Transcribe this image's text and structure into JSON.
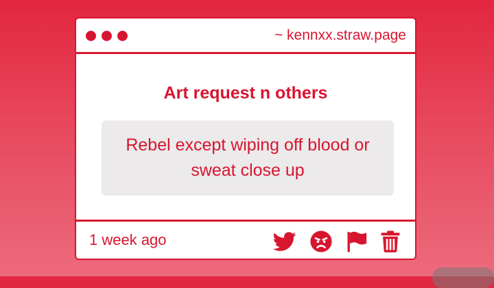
{
  "window": {
    "site_label": "~ kennxx.straw.page"
  },
  "post": {
    "heading": "Art request n others",
    "message": "Rebel except wiping off blood or sweat close up",
    "timestamp": "1 week ago"
  },
  "actions": [
    {
      "icon": "twitter-icon",
      "label": "Share on Twitter"
    },
    {
      "icon": "angry-face-icon",
      "label": "React"
    },
    {
      "icon": "flag-icon",
      "label": "Report"
    },
    {
      "icon": "trash-icon",
      "label": "Delete"
    }
  ],
  "colors": {
    "accent": "#d8152f",
    "background_top": "#e2263f",
    "background_bottom": "#ec6a7c",
    "card": "#ffffff",
    "message_box": "#eceaeb"
  }
}
